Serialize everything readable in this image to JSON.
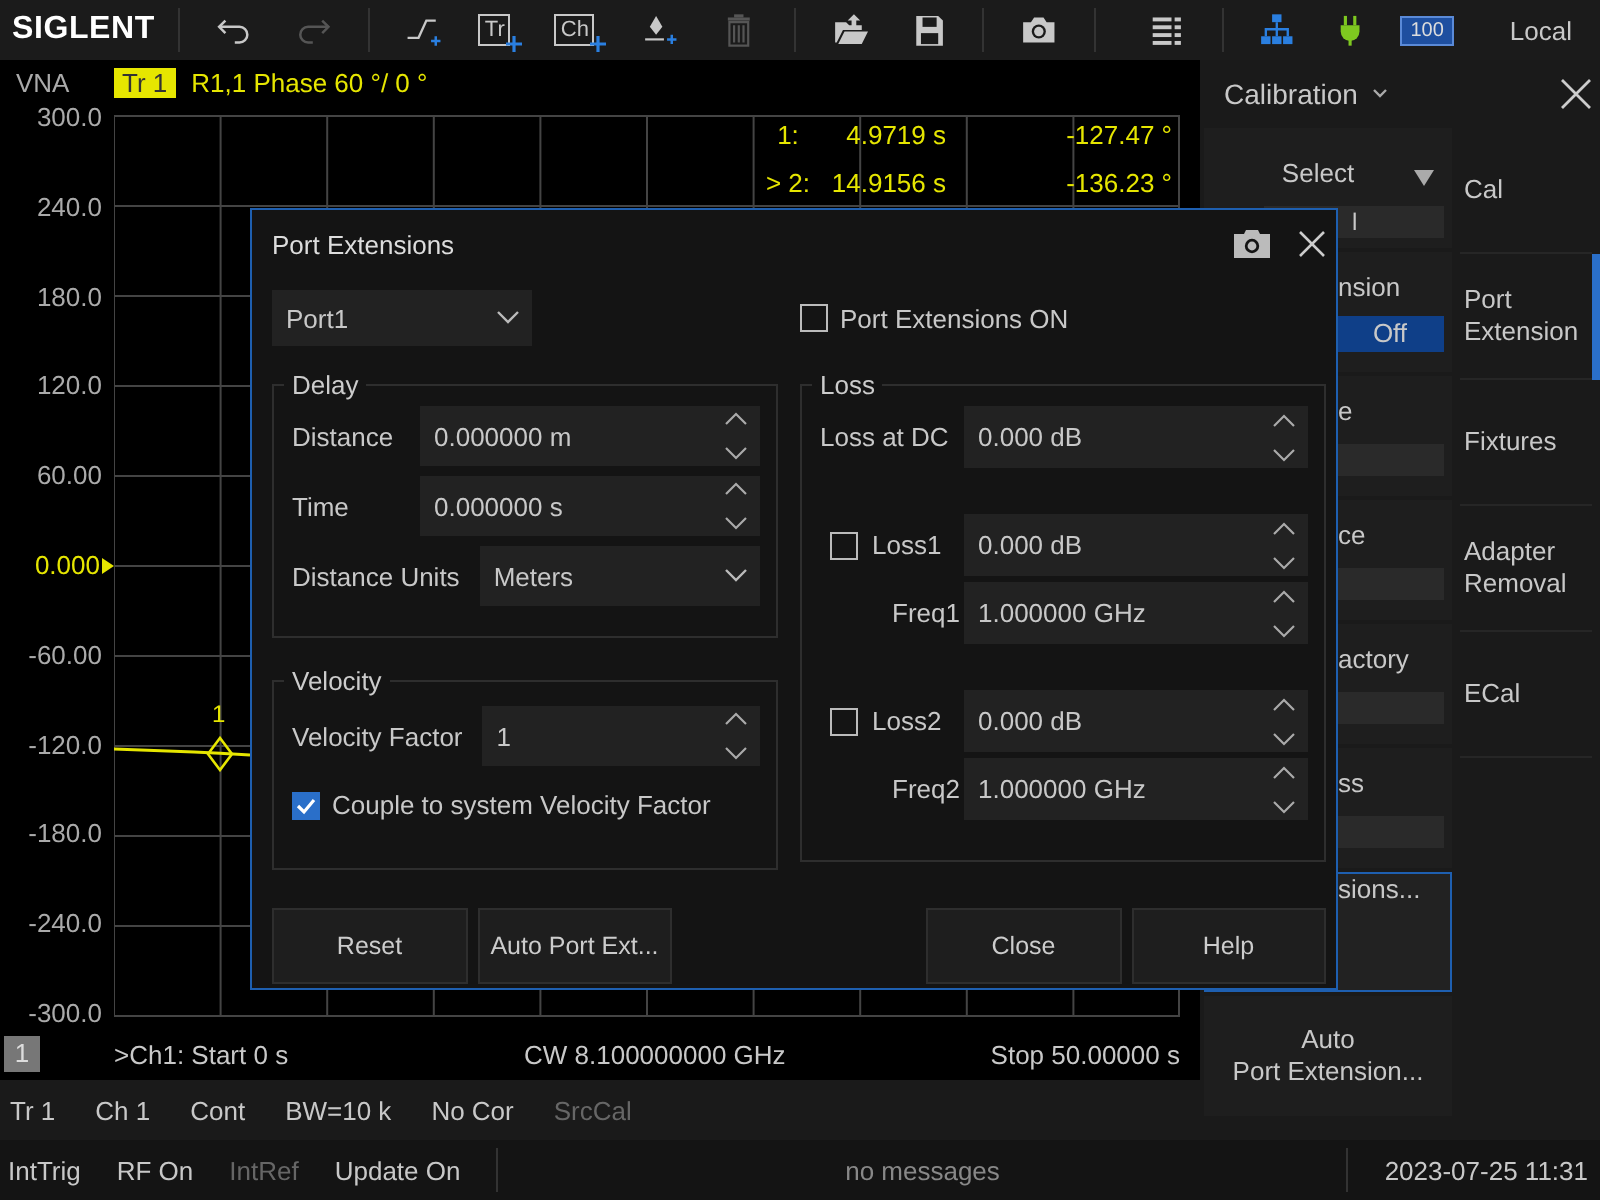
{
  "toolbar": {
    "logo": "SIGLENT",
    "groups": [
      [
        {
          "kind": "undo",
          "disabled": false
        },
        {
          "kind": "redo",
          "disabled": true
        }
      ],
      [
        {
          "kind": "step-add",
          "disabled": false
        },
        {
          "kind": "trace-add",
          "label": "Tr",
          "disabled": false
        },
        {
          "kind": "channel-add",
          "label": "Ch",
          "disabled": false
        },
        {
          "kind": "marker-add",
          "disabled": false
        },
        {
          "kind": "delete",
          "disabled": true
        }
      ],
      [
        {
          "kind": "open",
          "disabled": false
        },
        {
          "kind": "save",
          "disabled": false
        }
      ],
      [
        {
          "kind": "camera",
          "disabled": false
        }
      ]
    ],
    "battery": "100",
    "mode": "Local"
  },
  "plot": {
    "instrument": "VNA",
    "trace_tag": "Tr 1",
    "trace_info": "R1,1 Phase 60 °/ 0 °",
    "y_labels": [
      {
        "text": "300.0",
        "reference": false
      },
      {
        "text": "240.0",
        "reference": false
      },
      {
        "text": "180.0",
        "reference": false
      },
      {
        "text": "120.0",
        "reference": false
      },
      {
        "text": "60.00",
        "reference": false
      },
      {
        "text": "0.000",
        "reference": true
      },
      {
        "text": "-60.00",
        "reference": false
      },
      {
        "text": "-120.0",
        "reference": false
      },
      {
        "text": "-180.0",
        "reference": false
      },
      {
        "text": "-240.0",
        "reference": false
      },
      {
        "text": "-300.0",
        "reference": false
      }
    ],
    "markers": [
      {
        "label": "1:",
        "x": "4.9719 s",
        "y": "-127.47 °"
      },
      {
        "label": "> 2:",
        "x": "14.9156 s",
        "y": "-136.23 °"
      }
    ],
    "trace_marker": "1",
    "channel_tag": "1",
    "start": ">Ch1: Start 0 s",
    "center": "CW 8.100000000 GHz",
    "stop": "Stop 50.00000 s"
  },
  "trace_status": [
    {
      "text": "Tr 1",
      "disabled": false
    },
    {
      "text": "Ch 1",
      "disabled": false
    },
    {
      "text": "Cont",
      "disabled": false
    },
    {
      "text": "BW=10 k",
      "disabled": false
    },
    {
      "text": "No Cor",
      "disabled": false
    },
    {
      "text": "SrcCal",
      "disabled": true
    }
  ],
  "side_panel": {
    "title": "Calibration",
    "softkeys": [
      {
        "kind": "dropdown",
        "label": "Select",
        "value": "l",
        "selected": false
      },
      {
        "kind": "toggle",
        "label": "nsion",
        "value": "Off",
        "selected": false
      },
      {
        "kind": "field",
        "label": "e",
        "selected": false
      },
      {
        "kind": "field",
        "label": "ce",
        "selected": false
      },
      {
        "kind": "field",
        "label": "actory",
        "selected": false
      },
      {
        "kind": "field",
        "label": "ss",
        "selected": false
      },
      {
        "kind": "action",
        "label": "sions...",
        "selected": true
      },
      {
        "kind": "action",
        "label": "Auto\nPort Extension...",
        "selected": false
      }
    ],
    "tabs": [
      {
        "label": "Cal",
        "selected": false
      },
      {
        "label": "Port Extension",
        "selected": true
      },
      {
        "label": "Fixtures",
        "selected": false
      },
      {
        "label": "Adapter Removal",
        "selected": false
      },
      {
        "label": "ECal",
        "selected": false
      }
    ]
  },
  "dialog": {
    "title": "Port Extensions",
    "port": "Port1",
    "enable": {
      "label": "Port Extensions ON",
      "checked": false
    },
    "delay": {
      "title": "Delay",
      "rows": [
        {
          "kind": "spin",
          "label": "Distance",
          "value": "0.000000 m"
        },
        {
          "kind": "spin",
          "label": "Time",
          "value": "0.000000 s"
        },
        {
          "kind": "select",
          "label": "Distance Units",
          "value": "Meters"
        }
      ]
    },
    "velocity": {
      "title": "Velocity",
      "label": "Velocity Factor",
      "value": "1",
      "couple": {
        "label": "Couple to system Velocity Factor",
        "checked": true
      }
    },
    "loss": {
      "title": "Loss",
      "dc_label": "Loss at DC",
      "dc_value": "0.000 dB",
      "terms": [
        {
          "label": "Loss1",
          "checked": false,
          "value": "0.000 dB",
          "freq_label": "Freq1",
          "freq": "1.000000 GHz"
        },
        {
          "label": "Loss2",
          "checked": false,
          "value": "0.000 dB",
          "freq_label": "Freq2",
          "freq": "1.000000 GHz"
        }
      ]
    },
    "buttons": [
      "Reset",
      "Auto Port Ext...",
      "Close",
      "Help"
    ]
  },
  "status_bar": {
    "items": [
      {
        "text": "IntTrig",
        "disabled": false
      },
      {
        "text": "RF On",
        "disabled": false
      },
      {
        "text": "IntRef",
        "disabled": true
      },
      {
        "text": "Update On",
        "disabled": false
      }
    ],
    "message": "no messages",
    "datetime": "2023-07-25 11:31"
  }
}
